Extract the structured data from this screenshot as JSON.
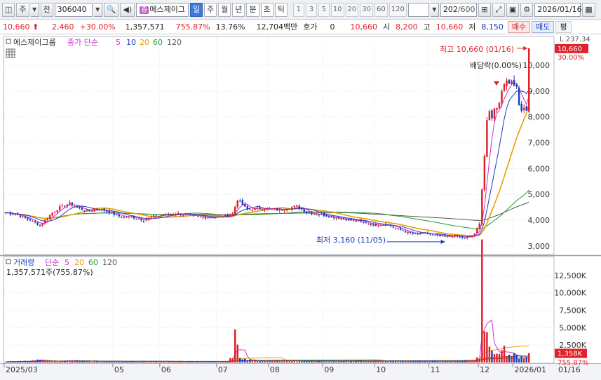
{
  "toolbar": {
    "market": "주",
    "prev": "전",
    "code": "306040",
    "stock_badge": "증",
    "stock_name": "에스제이그",
    "periods": [
      "일",
      "주",
      "월",
      "년",
      "분",
      "초",
      "틱"
    ],
    "active_period": "일",
    "intervals": [
      "1",
      "3",
      "5",
      "10",
      "20",
      "30",
      "60",
      "120"
    ],
    "count": "202",
    "count_total": "/600",
    "date": "2026/01/16"
  },
  "info": {
    "price": "10,660",
    "change": "2,460",
    "change_pct": "+30.00%",
    "volume": "1,357,571",
    "volume_ratio": "755.87%",
    "turnover": "13.76%",
    "amount": "12,704백만",
    "quote_label": "호가",
    "quote_value": "0",
    "quote_price": "10,660",
    "open_label": "시",
    "open": "8,200",
    "high_label": "고",
    "high": "10,660",
    "low_label": "저",
    "low": "8,150",
    "buy": "매수",
    "sell": "매도",
    "eval": "평"
  },
  "price_panel": {
    "name": "에스제이그룹",
    "indicator": "종가 단순",
    "ma_labels": [
      "5",
      "10",
      "20",
      "60",
      "120"
    ],
    "ma_colors": [
      "#d030d0",
      "#1a3dbe",
      "#e8a000",
      "#2a9a30",
      "#555555"
    ],
    "high_note": "최고 10,660 (01/16)",
    "low_note": "최저 3,160 (11/05)",
    "dividend_note": "배당락(0.00%)",
    "current_tag": "10,660",
    "current_pct": "30.00%",
    "scale_top": "237.34"
  },
  "volume_panel": {
    "name": "거래량",
    "indicator": "단순",
    "ma_labels": [
      "5",
      "20",
      "60",
      "120"
    ],
    "ma_colors": [
      "#d030d0",
      "#e8a000",
      "#2a9a30",
      "#555555"
    ],
    "volume_text": "1,357,571주(755.87%)",
    "current_tag": "1,358K",
    "current_pct": "755.87%"
  },
  "x_axis": {
    "labels": [
      "2025/03",
      "05",
      "06",
      "07",
      "08",
      "09",
      "10",
      "11",
      "12",
      "2026/01"
    ],
    "right_label": "01/16"
  },
  "chart_data": [
    {
      "type": "candlestick",
      "title": "에스제이그룹",
      "ylim": [
        2750,
        10900
      ],
      "y_ticks": [
        3000,
        4000,
        5000,
        6000,
        7000,
        8000,
        9000,
        10000
      ],
      "y_tick_labels": [
        "3,000",
        "4,000",
        "5,000",
        "6,000",
        "7,000",
        "8,000",
        "9,000",
        "10,000"
      ],
      "x_range": [
        "2025/03",
        "2026/01/16"
      ],
      "close_waypoints": [
        [
          0,
          4300
        ],
        [
          5,
          4200
        ],
        [
          10,
          4000
        ],
        [
          14,
          3800
        ],
        [
          18,
          4200
        ],
        [
          22,
          4500
        ],
        [
          26,
          4650
        ],
        [
          30,
          4450
        ],
        [
          34,
          4350
        ],
        [
          38,
          4450
        ],
        [
          42,
          4300
        ],
        [
          46,
          4150
        ],
        [
          52,
          4100
        ],
        [
          56,
          4000
        ],
        [
          60,
          4150
        ],
        [
          64,
          4200
        ],
        [
          70,
          4250
        ],
        [
          76,
          4150
        ],
        [
          82,
          4100
        ],
        [
          88,
          4150
        ],
        [
          92,
          4250
        ],
        [
          94,
          4800
        ],
        [
          96,
          4600
        ],
        [
          98,
          4400
        ],
        [
          102,
          4450
        ],
        [
          106,
          4450
        ],
        [
          110,
          4400
        ],
        [
          114,
          4450
        ],
        [
          118,
          4550
        ],
        [
          122,
          4300
        ],
        [
          128,
          4200
        ],
        [
          134,
          4100
        ],
        [
          140,
          4000
        ],
        [
          146,
          3900
        ],
        [
          150,
          3800
        ],
        [
          154,
          3850
        ],
        [
          158,
          3700
        ],
        [
          162,
          3550
        ],
        [
          166,
          3450
        ],
        [
          170,
          3500
        ],
        [
          174,
          3400
        ],
        [
          178,
          3350
        ],
        [
          182,
          3400
        ],
        [
          186,
          3300
        ],
        [
          190,
          3450
        ],
        [
          192,
          3900
        ],
        [
          193,
          5200
        ],
        [
          194,
          6500
        ],
        [
          195,
          7800
        ],
        [
          196,
          8200
        ],
        [
          197,
          8000
        ],
        [
          198,
          8300
        ],
        [
          199,
          8400
        ],
        [
          200,
          8600
        ],
        [
          201,
          9000
        ],
        [
          202,
          9300
        ],
        [
          203,
          9500
        ],
        [
          204,
          9200
        ],
        [
          205,
          9400
        ],
        [
          206,
          9300
        ],
        [
          207,
          9200
        ],
        [
          208,
          8500
        ],
        [
          209,
          8200
        ],
        [
          210,
          8400
        ],
        [
          211,
          8200
        ],
        [
          212,
          10660
        ]
      ],
      "ma_series": [
        {
          "name": "5",
          "window": 5
        },
        {
          "name": "10",
          "window": 10
        },
        {
          "name": "20",
          "window": 20
        },
        {
          "name": "60",
          "window": 60
        },
        {
          "name": "120",
          "window": 120
        }
      ]
    },
    {
      "type": "bar",
      "title": "거래량",
      "ylim": [
        0,
        15000
      ],
      "y_ticks": [
        2500,
        5000,
        7500,
        10000,
        12500
      ],
      "y_tick_labels": [
        "2,500K",
        "5,000K",
        "7,500K",
        "10,000K",
        "12,500K"
      ],
      "volume_waypoints": [
        [
          0,
          120
        ],
        [
          10,
          180
        ],
        [
          14,
          350
        ],
        [
          20,
          140
        ],
        [
          26,
          260
        ],
        [
          34,
          150
        ],
        [
          40,
          120
        ],
        [
          50,
          110
        ],
        [
          60,
          130
        ],
        [
          70,
          110
        ],
        [
          80,
          120
        ],
        [
          90,
          140
        ],
        [
          92,
          900
        ],
        [
          93,
          3900
        ],
        [
          94,
          2100
        ],
        [
          95,
          900
        ],
        [
          96,
          500
        ],
        [
          100,
          250
        ],
        [
          110,
          300
        ],
        [
          120,
          220
        ],
        [
          130,
          180
        ],
        [
          140,
          160
        ],
        [
          150,
          200
        ],
        [
          160,
          240
        ],
        [
          170,
          200
        ],
        [
          180,
          180
        ],
        [
          190,
          300
        ],
        [
          192,
          900
        ],
        [
          193,
          14500
        ],
        [
          194,
          4800
        ],
        [
          195,
          3500
        ],
        [
          196,
          2200
        ],
        [
          197,
          1300
        ],
        [
          198,
          1500
        ],
        [
          200,
          1100
        ],
        [
          202,
          1800
        ],
        [
          204,
          900
        ],
        [
          206,
          1200
        ],
        [
          208,
          700
        ],
        [
          210,
          900
        ],
        [
          211,
          600
        ],
        [
          212,
          1358
        ]
      ]
    }
  ]
}
